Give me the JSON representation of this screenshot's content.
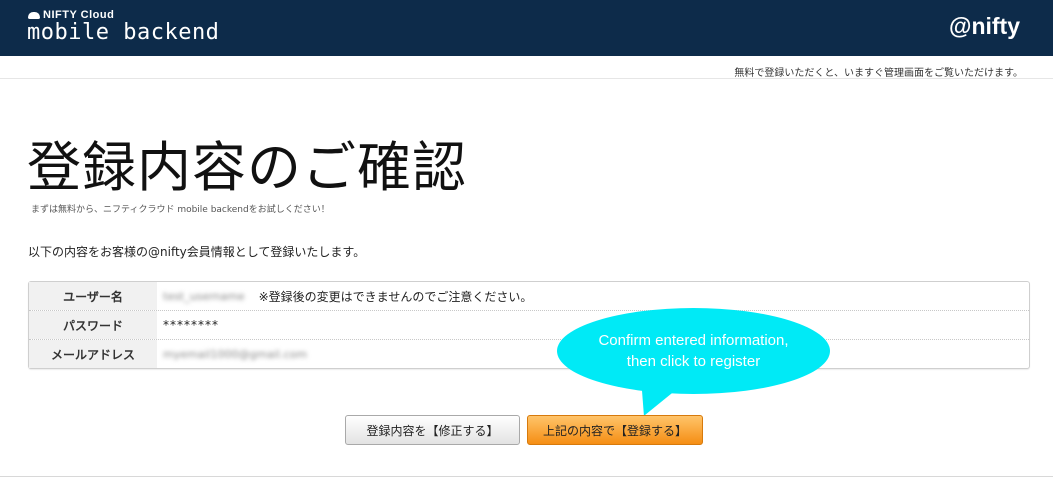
{
  "header": {
    "brand_small": "NIFTY Cloud",
    "brand_main": "mobile backend",
    "logo": "@nifty"
  },
  "subbar": {
    "text": "無料で登録いただくと、いますぐ管理画面をご覧いただけます。"
  },
  "main": {
    "title": "登録内容のご確認",
    "subtitle": "まずは無料から、ニフティクラウド mobile backendをお試しください！",
    "intro": "以下の内容をお客様の@nifty会員情報として登録いたします。",
    "rows": [
      {
        "label": "ユーザー名",
        "value": "test_username",
        "note": "※登録後の変更はできませんのでご注意ください。"
      },
      {
        "label": "パスワード",
        "value": "********"
      },
      {
        "label": "メールアドレス",
        "value": "myemail1000@gmail.com"
      }
    ]
  },
  "callout": {
    "line1": "Confirm entered information,",
    "line2": "then click to register"
  },
  "buttons": {
    "edit": "登録内容を【修正する】",
    "register": "上記の内容で【登録する】"
  },
  "colors": {
    "header_bg": "#0d2b4a",
    "callout": "#00eaf6",
    "register_button": "#f58e14"
  }
}
